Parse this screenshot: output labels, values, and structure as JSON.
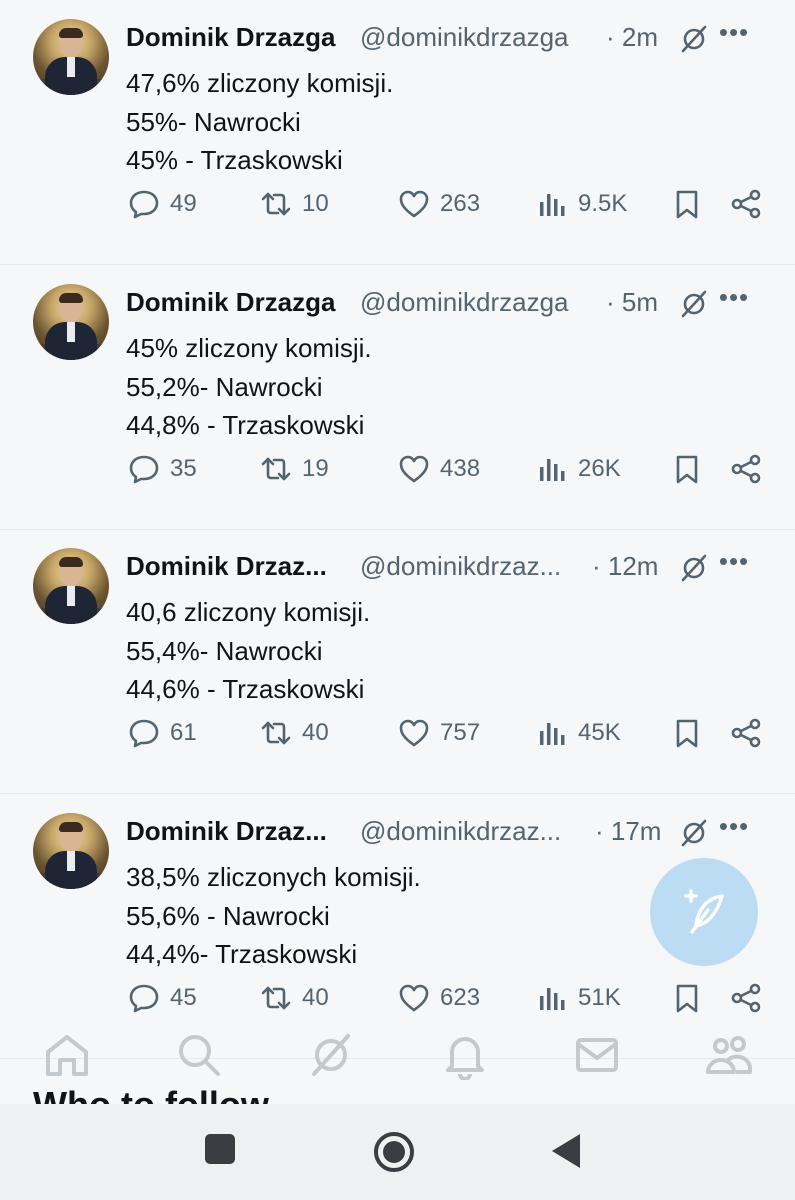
{
  "tweets": [
    {
      "name": "Dominik Drzazga",
      "handle": "@dominikdrzazga",
      "sep": "·",
      "time": "2m",
      "lines": [
        "47,6% zliczony komisji.",
        "55%- Nawrocki",
        "45% - Trzaskowski"
      ],
      "replies": "49",
      "retweets": "10",
      "likes": "263",
      "views": "9.5K"
    },
    {
      "name": "Dominik Drzazga",
      "handle": "@dominikdrzazga",
      "sep": "·",
      "time": "5m",
      "lines": [
        "45% zliczony komisji.",
        "55,2%- Nawrocki",
        "44,8% - Trzaskowski"
      ],
      "replies": "35",
      "retweets": "19",
      "likes": "438",
      "views": "26K"
    },
    {
      "name": "Dominik Drzaz...",
      "handle": "@dominikdrzaz...",
      "sep": "·",
      "time": "12m",
      "lines": [
        "40,6 zliczony komisji.",
        "55,4%- Nawrocki",
        "44,6% - Trzaskowski"
      ],
      "replies": "61",
      "retweets": "40",
      "likes": "757",
      "views": "45K"
    },
    {
      "name": "Dominik Drzaz...",
      "handle": "@dominikdrzaz...",
      "sep": "·",
      "time": "17m",
      "lines": [
        "38,5% zliczonych komisji.",
        "55,6% - Nawrocki",
        "44,4%- Trzaskowski"
      ],
      "replies": "45",
      "retweets": "40",
      "likes": "623",
      "views": "51K"
    }
  ],
  "who_to_follow": "Who to follow",
  "icons": {
    "reply": "comment-icon",
    "retweet": "retweet-icon",
    "like": "heart-icon",
    "views": "views-icon",
    "bookmark": "bookmark-icon",
    "share": "share-icon",
    "grok": "grok-icon",
    "more": "more-icon",
    "compose": "compose-icon",
    "nav": [
      "home-icon",
      "search-icon",
      "grok-icon",
      "notifications-icon",
      "messages-icon",
      "communities-icon"
    ],
    "system": [
      "recents-icon",
      "home-button-icon",
      "back-icon"
    ]
  },
  "colors": {
    "text": "#0f1419",
    "muted": "#536471",
    "fab": "#bcdcf4",
    "background": "#f6f7f8"
  }
}
